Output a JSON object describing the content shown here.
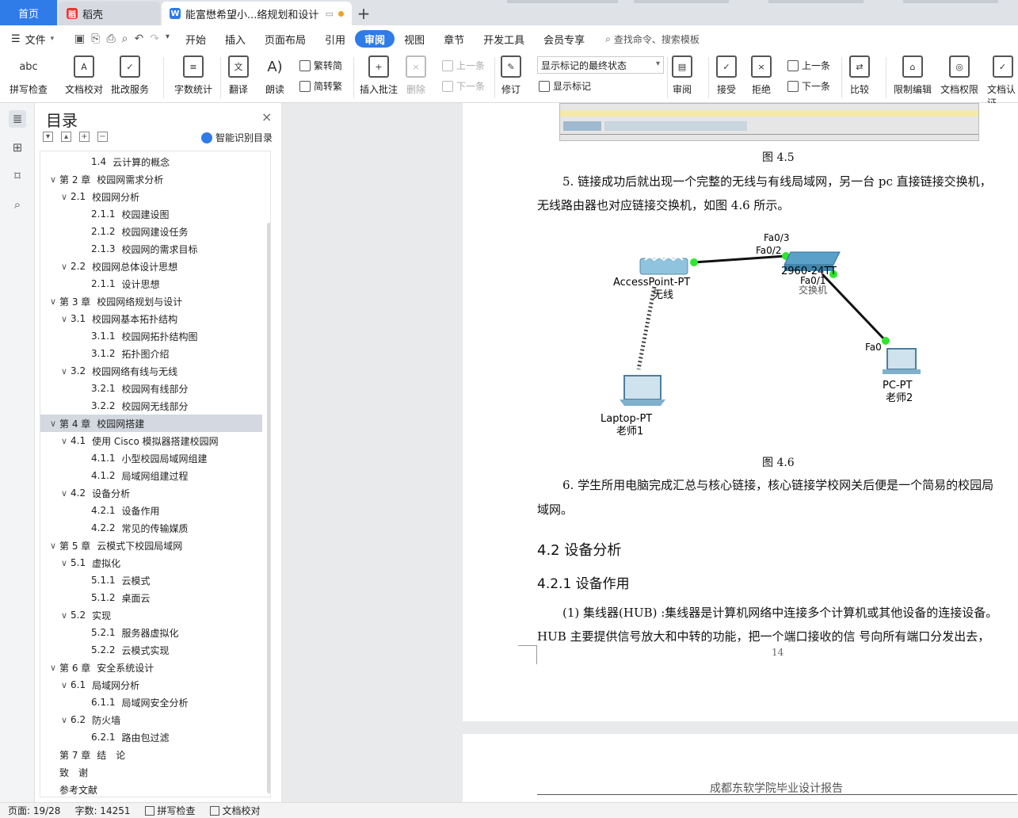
{
  "tabs": {
    "home": "首页",
    "daoke": "稻壳",
    "doc": "能富懋希望小...络规划和设计"
  },
  "menu": {
    "file": "文件",
    "items": [
      "开始",
      "插入",
      "页面布局",
      "引用",
      "审阅",
      "视图",
      "章节",
      "开发工具",
      "会员专享"
    ],
    "search": "查找命令、搜索模板"
  },
  "ribbon": {
    "spell": "拼写检查",
    "proof": "文档校对",
    "annotate_service": "批改服务",
    "word_count": "字数统计",
    "translate": "翻译",
    "read": "朗读",
    "trad": "繁转简",
    "simp": "简转繁",
    "insert_comment": "插入批注",
    "delete": "删除",
    "prev": "上一条",
    "next": "下一条",
    "revise": "修订",
    "markup_select": "显示标记的最终状态",
    "show_markup": "显示标记",
    "review": "审阅",
    "accept": "接受",
    "reject": "拒绝",
    "prev2": "上一条",
    "next2": "下一条",
    "compare": "比较",
    "restrict": "限制编辑",
    "perm": "文档权限",
    "cert": "文档认证"
  },
  "toc": {
    "title": "目录",
    "smart": "智能识别目录",
    "items": [
      {
        "level": 3,
        "num": "1.4",
        "text": "云计算的概念",
        "arrow": ""
      },
      {
        "level": 1,
        "num": "第 2 章",
        "text": "校园网需求分析",
        "arrow": "v"
      },
      {
        "level": 2,
        "num": "2.1",
        "text": "校园网分析",
        "arrow": "v"
      },
      {
        "level": 3,
        "num": "2.1.1",
        "text": "校园建设图",
        "arrow": ""
      },
      {
        "level": 3,
        "num": "2.1.2",
        "text": "校园网建设任务",
        "arrow": ""
      },
      {
        "level": 3,
        "num": "2.1.3",
        "text": "校园网的需求目标",
        "arrow": ""
      },
      {
        "level": 2,
        "num": "2.2",
        "text": "校园网总体设计思想",
        "arrow": "v"
      },
      {
        "level": 3,
        "num": "2.1.1",
        "text": "设计思想",
        "arrow": ""
      },
      {
        "level": 1,
        "num": "第 3 章",
        "text": "校园网络规划与设计",
        "arrow": "v"
      },
      {
        "level": 2,
        "num": "3.1",
        "text": "校园网基本拓扑结构",
        "arrow": "v"
      },
      {
        "level": 3,
        "num": "3.1.1",
        "text": "校园网拓扑结构图",
        "arrow": ""
      },
      {
        "level": 3,
        "num": "3.1.2",
        "text": "拓扑图介绍",
        "arrow": ""
      },
      {
        "level": 2,
        "num": "3.2",
        "text": "校园网络有线与无线",
        "arrow": "v"
      },
      {
        "level": 3,
        "num": "3.2.1",
        "text": "校园网有线部分",
        "arrow": ""
      },
      {
        "level": 3,
        "num": "3.2.2",
        "text": "校园网无线部分",
        "arrow": ""
      },
      {
        "level": 1,
        "num": "第 4 章",
        "text": "校园网搭建",
        "arrow": "v",
        "selected": true
      },
      {
        "level": 2,
        "num": "4.1",
        "text": "使用 Cisco 模拟器搭建校园网",
        "arrow": "v"
      },
      {
        "level": 3,
        "num": "4.1.1",
        "text": "小型校园局域网组建",
        "arrow": ""
      },
      {
        "level": 3,
        "num": "4.1.2",
        "text": "局域网组建过程",
        "arrow": ""
      },
      {
        "level": 2,
        "num": "4.2",
        "text": "设备分析",
        "arrow": "v"
      },
      {
        "level": 3,
        "num": "4.2.1",
        "text": "设备作用",
        "arrow": ""
      },
      {
        "level": 3,
        "num": "4.2.2",
        "text": "常见的传输媒质",
        "arrow": ""
      },
      {
        "level": 1,
        "num": "第 5 章",
        "text": "云模式下校园局域网",
        "arrow": "v"
      },
      {
        "level": 2,
        "num": "5.1",
        "text": "虚拟化",
        "arrow": "v"
      },
      {
        "level": 3,
        "num": "5.1.1",
        "text": "云模式",
        "arrow": ""
      },
      {
        "level": 3,
        "num": "5.1.2",
        "text": "桌面云",
        "arrow": ""
      },
      {
        "level": 2,
        "num": "5.2",
        "text": "实现",
        "arrow": "v"
      },
      {
        "level": 3,
        "num": "5.2.1",
        "text": "服务器虚拟化",
        "arrow": ""
      },
      {
        "level": 3,
        "num": "5.2.2",
        "text": "云模式实现",
        "arrow": ""
      },
      {
        "level": 1,
        "num": "第 6 章",
        "text": "安全系统设计",
        "arrow": "v"
      },
      {
        "level": 2,
        "num": "6.1",
        "text": "局域网分析",
        "arrow": "v"
      },
      {
        "level": 3,
        "num": "6.1.1",
        "text": "局域网安全分析",
        "arrow": ""
      },
      {
        "level": 2,
        "num": "6.2",
        "text": "防火墙",
        "arrow": "v"
      },
      {
        "level": 3,
        "num": "6.2.1",
        "text": "路由包过滤",
        "arrow": ""
      },
      {
        "level": 1,
        "num": "第 7 章",
        "text": "结　论",
        "arrow": ""
      },
      {
        "level": 1,
        "num": "致　谢",
        "text": "",
        "arrow": ""
      },
      {
        "level": 1,
        "num": "参考文献",
        "text": "",
        "arrow": ""
      }
    ]
  },
  "doc": {
    "fig45": "图 4.5",
    "para5_line1": "5. 链接成功后就出现一个完整的无线与有线局域网，另一台 pc 直接链接交换机，",
    "para5_line2": "无线路由器也对应链接交换机，如图 4.6 所示。",
    "fig46": "图 4.6",
    "para6_line1": "6. 学生所用电脑完成汇总与核心链接，核心链接学校网关后便是一个简易的校园局",
    "para6_line2": "域网。",
    "h42": "4.2  设备分析",
    "h421": "4.2.1 设备作用",
    "para7_line1": "(1) 集线器(HUB) :集线器是计算机网络中连接多个计算机或其他设备的连接设备。",
    "para7_line2": "HUB 主要提供信号放大和中转的功能，把一个端口接收的信  号向所有端口分发出去，",
    "pagenum": "14",
    "next_header": "成都东软学院毕业设计报告"
  },
  "diagram": {
    "ap_label": "AccessPoint-PT",
    "ap_name": "无线",
    "sw_label": "2960-24TT",
    "sw_port_top": "Fa0/3",
    "sw_port_left": "Fa0/2",
    "sw_port_bottom": "Fa0/1",
    "sw_name": "交换机",
    "pc_port": "Fa0",
    "pc_label": "PC-PT",
    "pc_name": "老师2",
    "laptop_label": "Laptop-PT",
    "laptop_name": "老师1"
  },
  "status": {
    "page": "页面: 19/28",
    "words": "字数: 14251",
    "spell": "拼写检查",
    "proof": "文档校对"
  }
}
